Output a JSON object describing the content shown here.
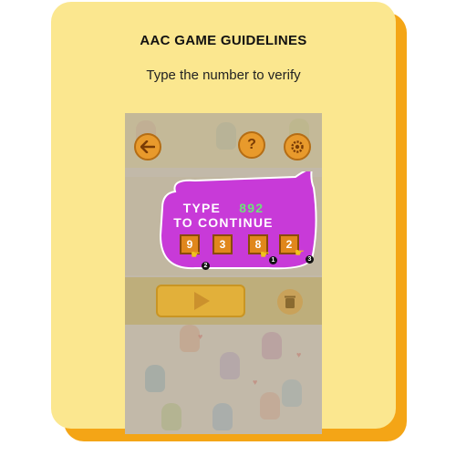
{
  "card": {
    "title": "AAC GAME GUIDELINES",
    "subtitle": "Type the number to verify"
  },
  "game": {
    "back_icon": "arrow-left-icon",
    "help_label": "?",
    "settings_icon": "gear-icon",
    "play_icon": "play-icon",
    "trash_icon": "trash-icon",
    "prompt": {
      "type_word": "TYPE",
      "code": "892",
      "line2": "TO CONTINUE"
    },
    "keys": [
      "9",
      "3",
      "8",
      "2"
    ],
    "steps": [
      "2",
      "1",
      "3"
    ],
    "colors": {
      "bubble": "#c83ad8",
      "code_green": "#6ee27a",
      "card": "#fbe78f",
      "card_shadow": "#f4a516",
      "button_orange": "#e89a2c"
    }
  }
}
